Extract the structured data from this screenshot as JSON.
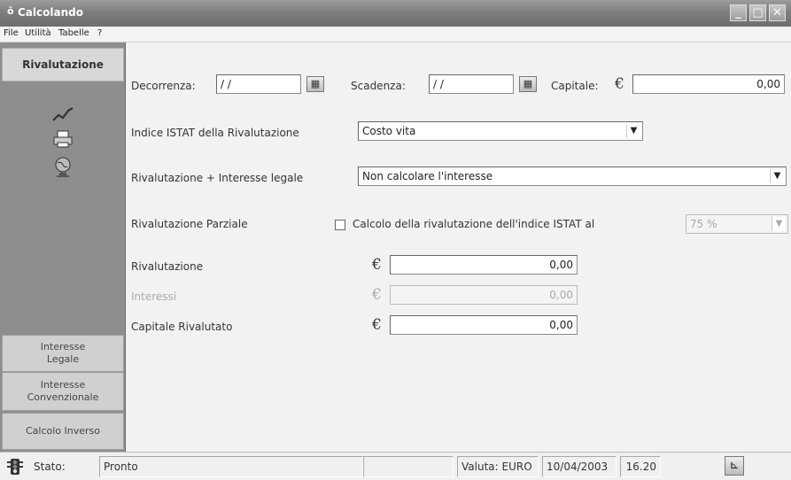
{
  "window": {
    "title": "Calcolando",
    "icon": "app-icon"
  },
  "menu": {
    "items": [
      "File",
      "Utilità",
      "Tabelle",
      "?"
    ]
  },
  "sidebar": {
    "header": "Rivalutazione",
    "icons": [
      "chart-line-icon",
      "printer-icon",
      "globe-icon"
    ],
    "buttons": [
      {
        "line1": "Interesse",
        "line2": "Legale"
      },
      {
        "line1": "Interesse",
        "line2": "Convenzionale"
      },
      {
        "line1": "Calcolo Inverso",
        "line2": ""
      }
    ]
  },
  "form": {
    "decorrenza_label": "Decorrenza:",
    "decorrenza_value": "/ /",
    "scadenza_label": "Scadenza:",
    "scadenza_value": "/ /",
    "capitale_label": "Capitale:",
    "capitale_value": "0,00",
    "currency_symbol": "€",
    "indice_label": "Indice ISTAT della Rivalutazione",
    "indice_value": "Costo vita",
    "interesse_label": "Rivalutazione + Interesse legale",
    "interesse_value": "Non calcolare l'interesse",
    "parziale_label": "Rivalutazione Parziale",
    "parziale_checkbox_label": "Calcolo della rivalutazione dell'indice ISTAT al",
    "parziale_checked": false,
    "parziale_percent": "75 %",
    "rivalutazione_label": "Rivalutazione",
    "rivalutazione_value": "0,00",
    "interessi_label": "Interessi",
    "interessi_value": "0,00",
    "capitale_rivalutato_label": "Capitale Rivalutato",
    "capitale_rivalutato_value": "0,00"
  },
  "status": {
    "label": "Stato:",
    "value": "Pronto",
    "valuta": "Valuta: EURO",
    "date": "10/04/2003",
    "time": "16.20"
  },
  "colors": {
    "sidebar_bg": "#8e8e8e",
    "titlebar_bg": "#7e7e7e"
  }
}
